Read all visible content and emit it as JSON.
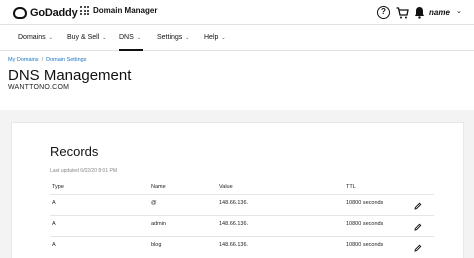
{
  "header": {
    "brand": "GoDaddy",
    "app_name": "Domain Manager",
    "help_symbol": "?",
    "user_name": "name",
    "user_caret": "⌄"
  },
  "nav": {
    "items": [
      {
        "label": "Domains"
      },
      {
        "label": "Buy & Sell"
      },
      {
        "label": "DNS",
        "active": true
      },
      {
        "label": "Settings"
      },
      {
        "label": "Help"
      }
    ],
    "caret": "⌄"
  },
  "breadcrumb": {
    "items": [
      "My Domains",
      "Domain Settings"
    ],
    "separator": "/"
  },
  "page": {
    "title": "DNS Management",
    "domain": "WANTTONO.COM"
  },
  "records": {
    "title": "Records",
    "last_updated": "Last updated 6/02/20 8:01 PM",
    "columns": [
      "Type",
      "Name",
      "Value",
      "TTL"
    ],
    "rows": [
      {
        "type": "A",
        "name": "@",
        "value": "148.66.136.",
        "ttl": "10800 seconds"
      },
      {
        "type": "A",
        "name": "admin",
        "value": "148.66.136.",
        "ttl": "10800 seconds"
      },
      {
        "type": "A",
        "name": "blog",
        "value": "148.66.136.",
        "ttl": "10800 seconds"
      }
    ]
  }
}
